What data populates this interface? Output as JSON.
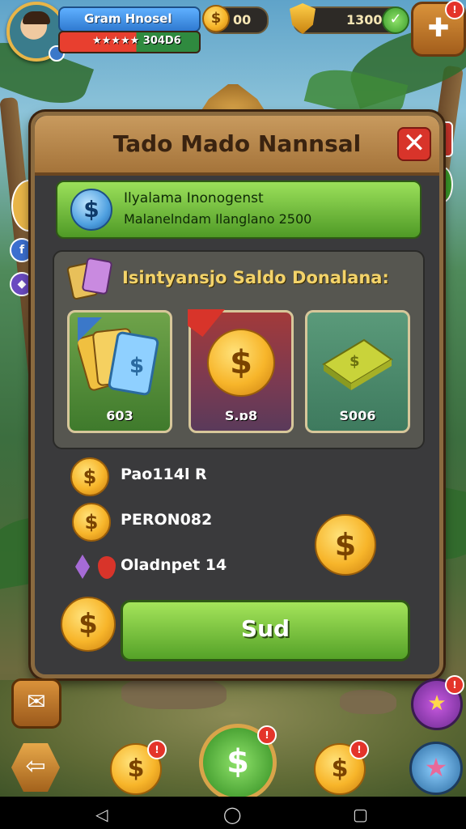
{
  "player": {
    "name": "Gram Hnosel",
    "xp_text": "★★★★★ 304D6"
  },
  "currency": {
    "coins": "00",
    "shields": "1300"
  },
  "modal": {
    "title": "Tado Mado Nannsal",
    "banner_line1": "Ilyalama Inonogenst",
    "banner_line2": "Malanelndam Ilanglano 2500",
    "offer_title": "Isintyansjo Saldo Donalana:",
    "offers": [
      {
        "price": "603"
      },
      {
        "price": "S.ɒ8"
      },
      {
        "price": "S006"
      }
    ],
    "rewards": [
      {
        "label": "Pao114l",
        "extra": "R"
      },
      {
        "label": "PERON082"
      },
      {
        "label": "Oladnpet 14"
      }
    ],
    "action_label": "Sud",
    "close_icon": "✕"
  },
  "badges": {
    "puzzle": "!",
    "bottom": "!"
  },
  "colors": {
    "accent_green": "#55a228",
    "frame_brown": "#8a6a3f",
    "close_red": "#d8342a"
  },
  "icons": [
    "avatar",
    "coin-icon",
    "shield-icon",
    "check-icon",
    "puzzle-icon",
    "facebook-icon",
    "gem-icon",
    "cards-icon",
    "dollar-coin-icon",
    "card-stack-icon",
    "cash-stack-icon",
    "ruby-icon",
    "mail-icon",
    "star-icon",
    "back-icon",
    "money-icon"
  ]
}
